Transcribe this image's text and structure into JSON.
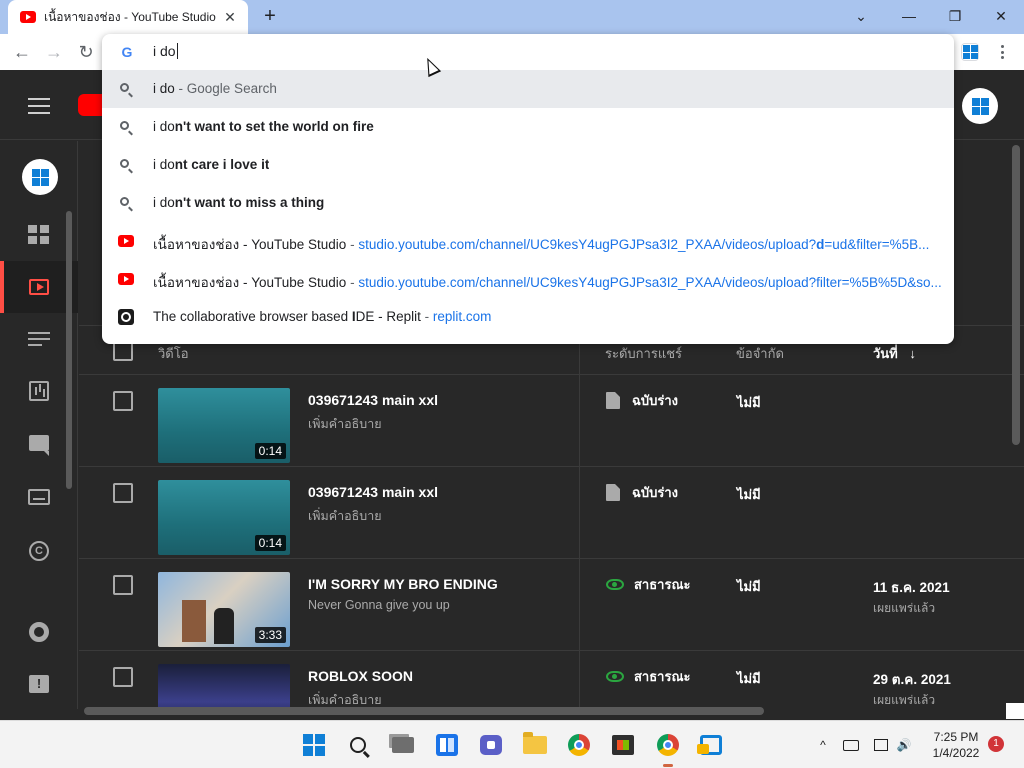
{
  "browser": {
    "tab_title": "เนื้อหาของช่อง - YouTube Studio",
    "tab_close": "✕",
    "new_tab": "+",
    "window": {
      "minimize": "⌄",
      "min": "—",
      "restore": "❐",
      "close": "✕"
    },
    "toolbar": {
      "back": "←",
      "forward": "→",
      "reload": "↻"
    }
  },
  "omnibox": {
    "input_value": "i do",
    "suggestions": [
      {
        "type": "search",
        "typed": "i do",
        "rest": "",
        "suffix": " - Google Search"
      },
      {
        "type": "search",
        "typed": "i do",
        "rest": "n't want to set the world on fire"
      },
      {
        "type": "search",
        "typed": "i do",
        "rest": "nt care i love it"
      },
      {
        "type": "search",
        "typed": "i do",
        "rest": "n't want to miss a thing"
      },
      {
        "type": "history",
        "title": "เนื้อหาของช่อง - YouTube Studio",
        "sep": " - ",
        "url_a": "studio.youtube.com/channel/UC9kesY4ugPGJPsa3I2_PXAA/videos/upload?",
        "url_b": "d",
        "url_c": "=ud&filter=%5B..."
      },
      {
        "type": "history",
        "title": "เนื้อหาของช่อง - YouTube Studio",
        "sep": " - ",
        "url_a": "studio.youtube.com/channel/UC9kesY4ugPGJPsa3I2_PXAA/videos/upload?filter=%5B%5D&so...",
        "url_b": "",
        "url_c": ""
      },
      {
        "type": "history",
        "title": "The collaborative browser based ",
        "title_bold": "I",
        "title_rest": "DE - Replit",
        "sep": " - ",
        "url_a": "replit.com",
        "url_b": "",
        "url_c": ""
      }
    ]
  },
  "table": {
    "headers": {
      "video": "วิดีโอ",
      "visibility": "ระดับการแชร์",
      "restrictions": "ข้อจำกัด",
      "date": "วันที่",
      "date_arrow": "↓"
    },
    "rows": [
      {
        "title": "039671243 main xxl",
        "desc": "เพิ่มคำอธิบาย",
        "duration": "0:14",
        "visibility": "ฉบับร่าง",
        "restrictions": "ไม่มี",
        "date": "",
        "date_status": ""
      },
      {
        "title": "039671243 main xxl",
        "desc": "เพิ่มคำอธิบาย",
        "duration": "0:14",
        "visibility": "ฉบับร่าง",
        "restrictions": "ไม่มี",
        "date": "",
        "date_status": ""
      },
      {
        "title": "I'M SORRY MY BRO ENDING",
        "desc": "Never Gonna give you up",
        "duration": "3:33",
        "visibility": "สาธารณะ",
        "restrictions": "ไม่มี",
        "date": "11 ธ.ค. 2021",
        "date_status": "เผยแพร่แล้ว"
      },
      {
        "title": "ROBLOX SOON",
        "desc": "เพิ่มคำอธิบาย",
        "duration": "",
        "visibility": "สาธารณะ",
        "restrictions": "ไม่มี",
        "date": "29 ต.ค. 2021",
        "date_status": "เผยแพร่แล้ว"
      }
    ]
  },
  "sidebar": {
    "copyright_glyph": "C",
    "feedback_glyph": "!"
  },
  "taskbar": {
    "time": "7:25 PM",
    "date": "1/4/2022",
    "notification_count": "1",
    "tray": {
      "chevron": "^",
      "volume": "🔊"
    }
  }
}
